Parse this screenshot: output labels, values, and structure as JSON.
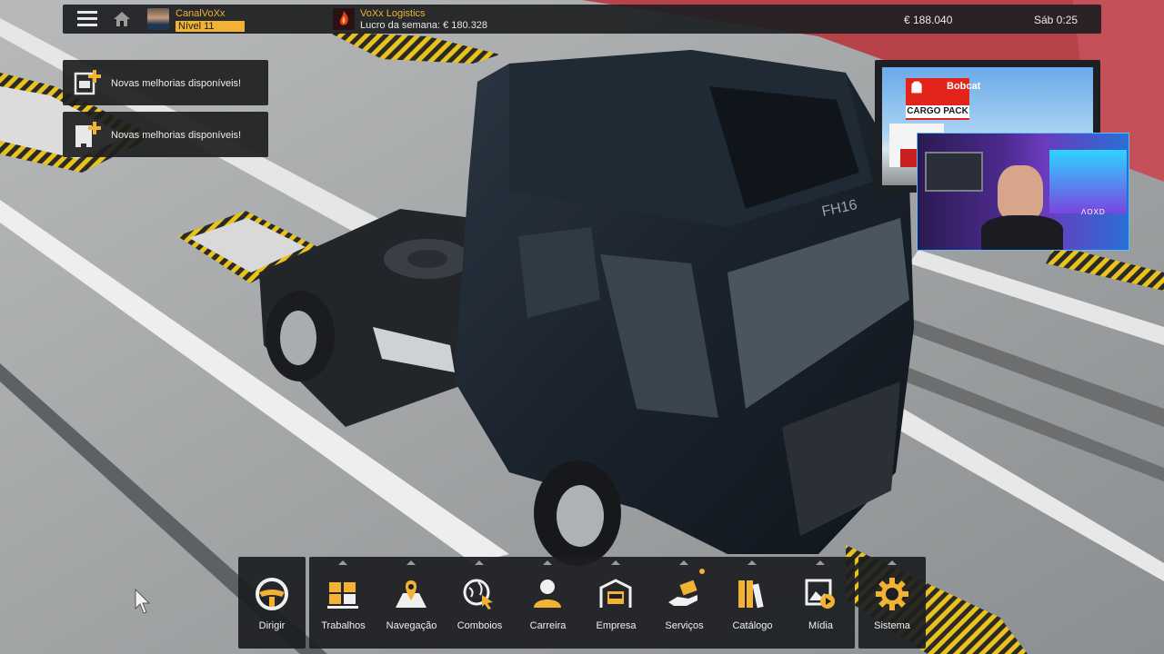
{
  "topbar": {
    "profile_name": "CanalVoXx",
    "profile_level": "Nível 11",
    "company_name": "VoXx Logistics",
    "company_profit": "Lucro da semana: € 180.328",
    "money": "€ 188.040",
    "clock": "Sáb 0:25"
  },
  "notifications": [
    {
      "text": "Novas melhorias disponíveis!"
    },
    {
      "text": "Novas melhorias disponíveis!"
    }
  ],
  "overlay": {
    "brand": "Bobcat",
    "pack": "CARGO PACK",
    "webcam_text": "ΛOXD"
  },
  "truck": {
    "badge": "FH16"
  },
  "dock": {
    "left": {
      "label": "Dirigir",
      "icon": "steering-wheel-icon"
    },
    "items": [
      {
        "label": "Trabalhos",
        "icon": "cargo-boxes-icon"
      },
      {
        "label": "Navegação",
        "icon": "map-pin-icon"
      },
      {
        "label": "Comboios",
        "icon": "globe-cursor-icon"
      },
      {
        "label": "Carreira",
        "icon": "person-icon"
      },
      {
        "label": "Empresa",
        "icon": "garage-truck-icon"
      },
      {
        "label": "Serviços",
        "icon": "services-hand-icon"
      },
      {
        "label": "Catálogo",
        "icon": "books-icon"
      },
      {
        "label": "Mídia",
        "icon": "media-icon"
      }
    ],
    "right": {
      "label": "Sistema",
      "icon": "gear-icon"
    }
  },
  "colors": {
    "accent": "#f2b233",
    "panel": "#1c1e21",
    "truck_body": "#1c2530",
    "floor": "#9a9d9f"
  }
}
